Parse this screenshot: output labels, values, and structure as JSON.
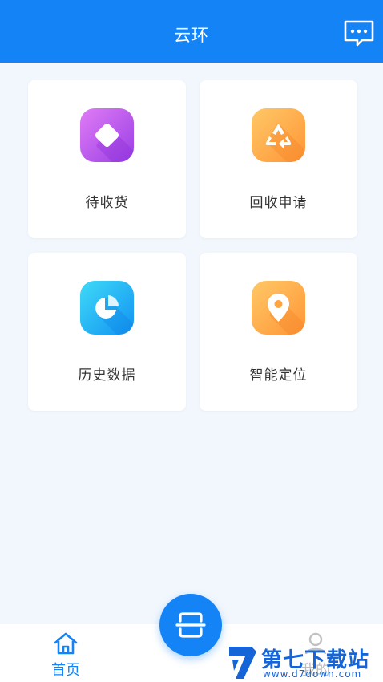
{
  "header": {
    "title": "云环",
    "message_icon": "message-bubble-icon"
  },
  "cards": [
    {
      "label": "待收货",
      "icon": "diamond-icon",
      "colors": [
        "#d46cf2",
        "#a445e6"
      ]
    },
    {
      "label": "回收申请",
      "icon": "recycle-icon",
      "colors": [
        "#ffc15e",
        "#ff9a3a"
      ]
    },
    {
      "label": "历史数据",
      "icon": "pie-chart-icon",
      "colors": [
        "#3ad3f6",
        "#1495f3"
      ]
    },
    {
      "label": "智能定位",
      "icon": "location-pin-icon",
      "colors": [
        "#ffc15e",
        "#ff9a3a"
      ]
    }
  ],
  "tabbar": {
    "home_label": "首页",
    "mine_label": "我的",
    "scan_icon": "scan-icon",
    "accent": "#1383f6"
  },
  "watermark": {
    "title": "第七下载站",
    "url": "www.d7down.com"
  }
}
